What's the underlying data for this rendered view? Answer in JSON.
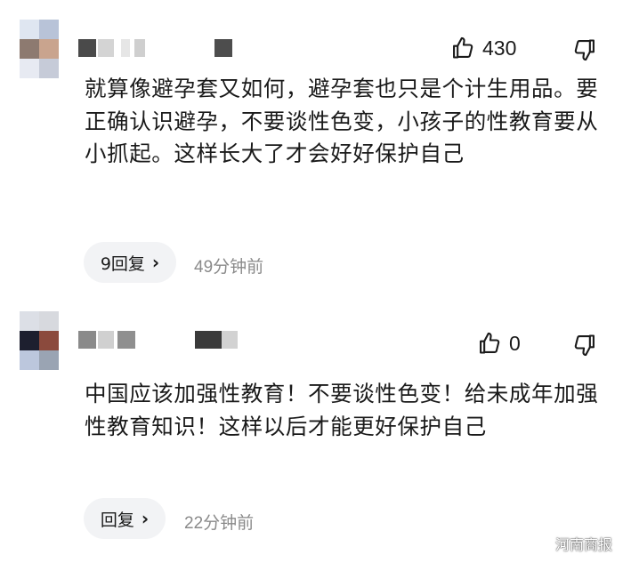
{
  "comments": [
    {
      "likes": "430",
      "text": "就算像避孕套又如何，避孕套也只是个计生用品。要正确认识避孕，不要谈性色变，小孩子的性教育要从小抓起。这样长大了才会好好保护自己",
      "reply_label": "9回复",
      "time": "49分钟前"
    },
    {
      "likes": "0",
      "text": "中国应该加强性教育！不要谈性色变！给未成年加强性教育知识！这样以后才能更好保护自己",
      "reply_label": "回复",
      "time": "22分钟前"
    }
  ],
  "icons": {
    "like": "thumbs-up-icon",
    "dislike": "thumbs-down-icon",
    "reply_chevron": "chevron-right-icon"
  },
  "watermark": {
    "text": "河南商报"
  },
  "colors": {
    "text": "#1a1a1a",
    "muted": "#8a8a8a",
    "reply_bg": "#f2f3f5"
  }
}
